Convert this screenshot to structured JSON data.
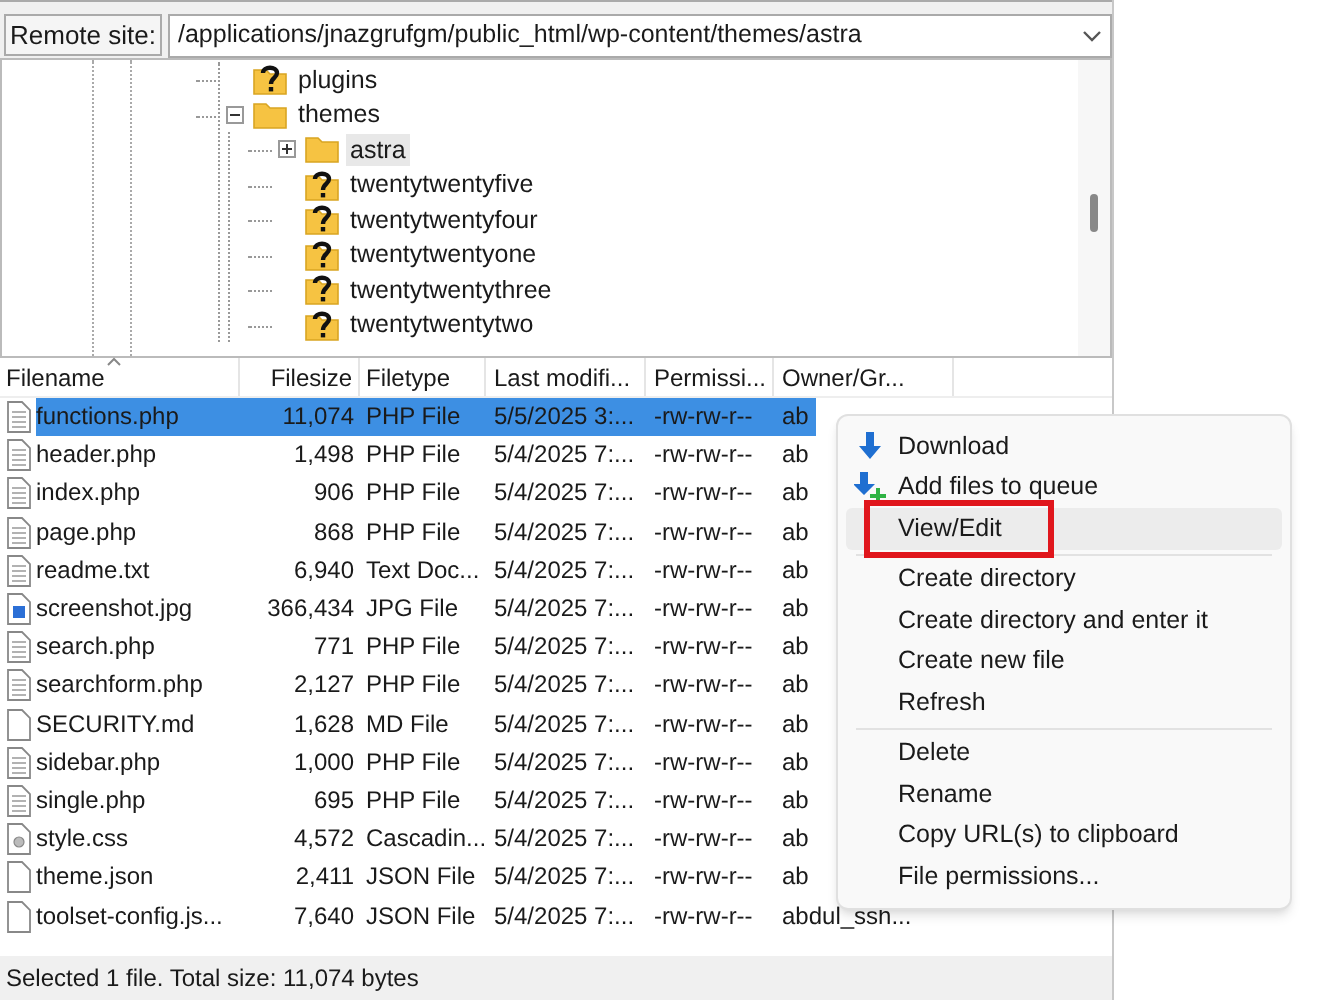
{
  "remote_site": {
    "label": "Remote site:",
    "path": "/applications/jnazgrufgm/public_html/wp-content/themes/astra"
  },
  "tree": [
    {
      "name": "plugins",
      "kind": "unknown",
      "selected": false
    },
    {
      "name": "themes",
      "kind": "folder",
      "expanded": true,
      "selected": false,
      "children": [
        {
          "name": "astra",
          "kind": "folder",
          "expanded": false,
          "selected": true
        },
        {
          "name": "twentytwentyfive",
          "kind": "unknown",
          "selected": false
        },
        {
          "name": "twentytwentyfour",
          "kind": "unknown",
          "selected": false
        },
        {
          "name": "twentytwentyone",
          "kind": "unknown",
          "selected": false
        },
        {
          "name": "twentytwentythree",
          "kind": "unknown",
          "selected": false
        },
        {
          "name": "twentytwentytwo",
          "kind": "unknown",
          "selected": false
        }
      ]
    }
  ],
  "table": {
    "columns": [
      "Filename",
      "Filesize",
      "Filetype",
      "Last modifi...",
      "Permissi...",
      "Owner/Gr..."
    ],
    "rows": [
      {
        "kind": "text",
        "selected": true,
        "cells": [
          "functions.php",
          "11,074",
          "PHP File",
          "5/5/2025 3:...",
          "-rw-rw-r--",
          "ab"
        ]
      },
      {
        "kind": "text",
        "selected": false,
        "cells": [
          "header.php",
          "1,498",
          "PHP File",
          "5/4/2025 7:...",
          "-rw-rw-r--",
          "ab"
        ]
      },
      {
        "kind": "text",
        "selected": false,
        "cells": [
          "index.php",
          "906",
          "PHP File",
          "5/4/2025 7:...",
          "-rw-rw-r--",
          "ab"
        ]
      },
      {
        "kind": "text",
        "selected": false,
        "cells": [
          "page.php",
          "868",
          "PHP File",
          "5/4/2025 7:...",
          "-rw-rw-r--",
          "ab"
        ]
      },
      {
        "kind": "text",
        "selected": false,
        "cells": [
          "readme.txt",
          "6,940",
          "Text Doc...",
          "5/4/2025 7:...",
          "-rw-rw-r--",
          "ab"
        ]
      },
      {
        "kind": "image",
        "selected": false,
        "cells": [
          "screenshot.jpg",
          "366,434",
          "JPG File",
          "5/4/2025 7:...",
          "-rw-rw-r--",
          "ab"
        ]
      },
      {
        "kind": "text",
        "selected": false,
        "cells": [
          "search.php",
          "771",
          "PHP File",
          "5/4/2025 7:...",
          "-rw-rw-r--",
          "ab"
        ]
      },
      {
        "kind": "text",
        "selected": false,
        "cells": [
          "searchform.php",
          "2,127",
          "PHP File",
          "5/4/2025 7:...",
          "-rw-rw-r--",
          "ab"
        ]
      },
      {
        "kind": "blank",
        "selected": false,
        "cells": [
          "SECURITY.md",
          "1,628",
          "MD File",
          "5/4/2025 7:...",
          "-rw-rw-r--",
          "ab"
        ]
      },
      {
        "kind": "text",
        "selected": false,
        "cells": [
          "sidebar.php",
          "1,000",
          "PHP File",
          "5/4/2025 7:...",
          "-rw-rw-r--",
          "ab"
        ]
      },
      {
        "kind": "text",
        "selected": false,
        "cells": [
          "single.php",
          "695",
          "PHP File",
          "5/4/2025 7:...",
          "-rw-rw-r--",
          "ab"
        ]
      },
      {
        "kind": "css",
        "selected": false,
        "cells": [
          "style.css",
          "4,572",
          "Cascadin...",
          "5/4/2025 7:...",
          "-rw-rw-r--",
          "ab"
        ]
      },
      {
        "kind": "blank",
        "selected": false,
        "cells": [
          "theme.json",
          "2,411",
          "JSON File",
          "5/4/2025 7:...",
          "-rw-rw-r--",
          "ab"
        ]
      },
      {
        "kind": "blank",
        "selected": false,
        "cells": [
          "toolset-config.js...",
          "7,640",
          "JSON File",
          "5/4/2025 7:...",
          "-rw-rw-r--",
          "abdul_ssh..."
        ]
      }
    ]
  },
  "context_menu": {
    "groups": [
      [
        {
          "label": "Download",
          "kind": "download",
          "selected": false,
          "outlined": false
        },
        {
          "label": "Add files to queue",
          "kind": "queue",
          "selected": false,
          "outlined": false
        },
        {
          "label": "View/Edit",
          "kind": "plain",
          "selected": true,
          "outlined": true
        }
      ],
      [
        {
          "label": "Create directory",
          "kind": "plain",
          "selected": false,
          "outlined": false
        },
        {
          "label": "Create directory and enter it",
          "kind": "plain",
          "selected": false,
          "outlined": false
        },
        {
          "label": "Create new file",
          "kind": "plain",
          "selected": false,
          "outlined": false
        },
        {
          "label": "Refresh",
          "kind": "plain",
          "selected": false,
          "outlined": false
        }
      ],
      [
        {
          "label": "Delete",
          "kind": "plain",
          "selected": false,
          "outlined": false
        },
        {
          "label": "Rename",
          "kind": "plain",
          "selected": false,
          "outlined": false
        },
        {
          "label": "Copy URL(s) to clipboard",
          "kind": "plain",
          "selected": false,
          "outlined": false
        },
        {
          "label": "File permissions...",
          "kind": "plain",
          "selected": false,
          "outlined": false
        }
      ]
    ]
  },
  "status_bar": "Selected 1 file. Total size: 11,074 bytes"
}
